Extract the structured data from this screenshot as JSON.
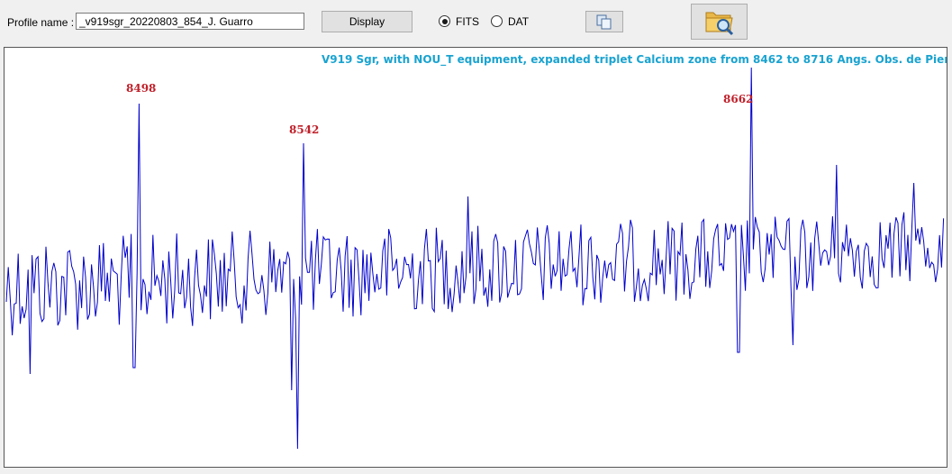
{
  "toolbar": {
    "profile_label": "Profile name :",
    "profile_value": "_v919sgr_20220803_854_J. Guarro",
    "display_label": "Display",
    "fits_label": "FITS",
    "fits_checked": true,
    "dat_label": "DAT",
    "dat_checked": false,
    "copy_icon": "copy-icon",
    "open_icon": "folder-search-icon"
  },
  "chart_data": {
    "type": "line",
    "title": "V919 Sgr, with NOU_T equipment, expanded triplet Calcium zone from 8462 to 8716 Angs. Obs. de Piera.",
    "line_color": "#0000cc",
    "title_color": "#1aa3d0",
    "annotation_color": "#c0202a",
    "xlim": [
      8462,
      8716
    ],
    "grid": false,
    "annotations": [
      {
        "label": "8498",
        "x": 8498
      },
      {
        "label": "8542",
        "x": 8542
      },
      {
        "label": "8662",
        "x": 8662
      }
    ]
  }
}
